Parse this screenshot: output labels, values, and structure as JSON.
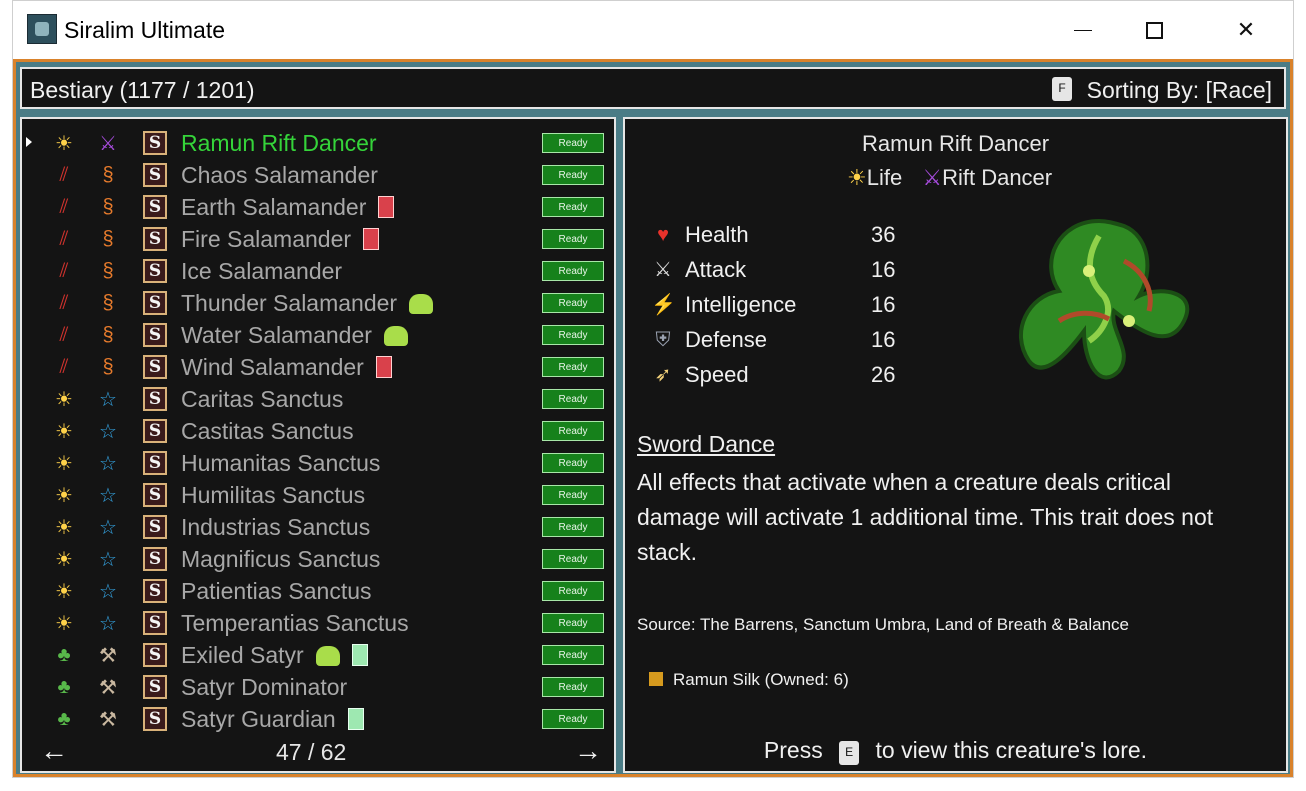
{
  "window": {
    "title": "Siralim Ultimate",
    "controls": [
      "—",
      "□",
      "✕"
    ]
  },
  "header": {
    "title": "Bestiary (1177 / 1201)",
    "sort_key": "F",
    "sort_label": "Sorting By: [Race]"
  },
  "list": {
    "ready_label": "Ready",
    "rows": [
      {
        "name": "Ramun Rift Dancer",
        "class": "sun",
        "race": "rift",
        "extra": "",
        "selected": true
      },
      {
        "name": "Chaos Salamander",
        "class": "claw",
        "race": "serpent",
        "extra": ""
      },
      {
        "name": "Earth Salamander",
        "class": "claw",
        "race": "serpent",
        "extra": "card"
      },
      {
        "name": "Fire Salamander",
        "class": "claw",
        "race": "serpent",
        "extra": "card"
      },
      {
        "name": "Ice Salamander",
        "class": "claw",
        "race": "serpent",
        "extra": ""
      },
      {
        "name": "Thunder Salamander",
        "class": "claw",
        "race": "serpent",
        "extra": "slime"
      },
      {
        "name": "Water Salamander",
        "class": "claw",
        "race": "serpent",
        "extra": "slime"
      },
      {
        "name": "Wind Salamander",
        "class": "claw",
        "race": "serpent",
        "extra": "card"
      },
      {
        "name": "Caritas Sanctus",
        "class": "sun",
        "race": "star",
        "extra": ""
      },
      {
        "name": "Castitas Sanctus",
        "class": "sun",
        "race": "star",
        "extra": ""
      },
      {
        "name": "Humanitas Sanctus",
        "class": "sun",
        "race": "star",
        "extra": ""
      },
      {
        "name": "Humilitas Sanctus",
        "class": "sun",
        "race": "star",
        "extra": ""
      },
      {
        "name": "Industrias Sanctus",
        "class": "sun",
        "race": "star",
        "extra": ""
      },
      {
        "name": "Magnificus Sanctus",
        "class": "sun",
        "race": "star",
        "extra": ""
      },
      {
        "name": "Patientias Sanctus",
        "class": "sun",
        "race": "star",
        "extra": ""
      },
      {
        "name": "Temperantias Sanctus",
        "class": "sun",
        "race": "star",
        "extra": ""
      },
      {
        "name": "Exiled Satyr",
        "class": "leaf",
        "race": "hoof",
        "extra": "slime,green"
      },
      {
        "name": "Satyr Dominator",
        "class": "leaf",
        "race": "hoof",
        "extra": ""
      },
      {
        "name": "Satyr Guardian",
        "class": "leaf",
        "race": "hoof",
        "extra": "green"
      }
    ],
    "pager": {
      "prev": "←",
      "next": "→",
      "label": "47 / 62"
    }
  },
  "detail": {
    "name": "Ramun Rift Dancer",
    "class_label": "Life",
    "race_label": "Rift Dancer",
    "stats": [
      {
        "icon": "heart-icon",
        "label": "Health",
        "value": "36"
      },
      {
        "icon": "sword-icon",
        "label": "Attack",
        "value": "16"
      },
      {
        "icon": "lightning-icon",
        "label": "Intelligence",
        "value": "16"
      },
      {
        "icon": "shield-icon",
        "label": "Defense",
        "value": "16"
      },
      {
        "icon": "wing-icon",
        "label": "Speed",
        "value": "26"
      }
    ],
    "trait_title": "Sword Dance",
    "trait_desc": "All effects that activate when a creature deals critical damage will activate 1 additional time. This trait does not stack.",
    "source": "Source: The Barrens, Sanctum Umbra, Land of Breath & Balance",
    "material": "Ramun Silk (Owned: 6)",
    "press_prefix": "Press",
    "press_key": "E",
    "press_suffix": "to view this creature's lore."
  },
  "colors": {
    "selected_name": "#35d43a",
    "ready_bg": "#16811b",
    "panel_bg": "#141414",
    "frame": "#e6e6e6",
    "orange_border": "#d9822b"
  }
}
